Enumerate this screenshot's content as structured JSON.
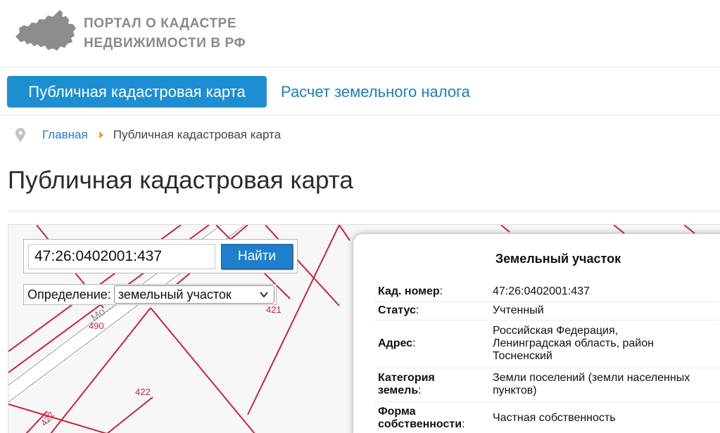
{
  "header": {
    "logo_line1": "ПОРТАЛ О КАДАСТРЕ",
    "logo_line2": "НЕДВИЖИМОСТИ В РФ",
    "logo_icon": "russia-map-icon"
  },
  "nav": {
    "active": "Публичная кадастровая карта",
    "link": "Расчет земельного налога"
  },
  "breadcrumb": {
    "icon": "location-pin-icon",
    "home": "Главная",
    "current": "Публичная кадастровая карта"
  },
  "page_title": "Публичная кадастровая карта",
  "search": {
    "value": "47:26:0402001:437",
    "button": "Найти"
  },
  "definition": {
    "label": "Определение:",
    "selected": "земельный участок"
  },
  "map": {
    "labels": [
      "490",
      "421",
      "422",
      "422",
      "Мо…ская"
    ]
  },
  "card": {
    "title": "Земельный участок",
    "rows": [
      {
        "label_bold": "Кад. номер",
        "label_suffix": ":",
        "value": "47:26:0402001:437"
      },
      {
        "label_bold": "Статус",
        "label_suffix": ":",
        "value": "Учтенный"
      },
      {
        "label_bold": "Адрес",
        "label_suffix": ":",
        "value_lines": [
          "Российская Федерация,",
          "Ленинградская область, район",
          "Тосненский"
        ]
      },
      {
        "label_bold_lines": [
          "Категория",
          "земель"
        ],
        "label_suffix": ":",
        "value_lines": [
          "Земли поселений (земли населенных",
          "пунктов)"
        ]
      },
      {
        "label_bold_lines": [
          "Форма",
          "собственности"
        ],
        "label_suffix": ":",
        "value": "Частная собственность"
      }
    ]
  },
  "colors": {
    "brand_blue": "#1e8ed2",
    "link_blue": "#1a7fc0",
    "plot_border_red": "#c8243a",
    "breadcrumb_arrow": "#f29b1d"
  }
}
